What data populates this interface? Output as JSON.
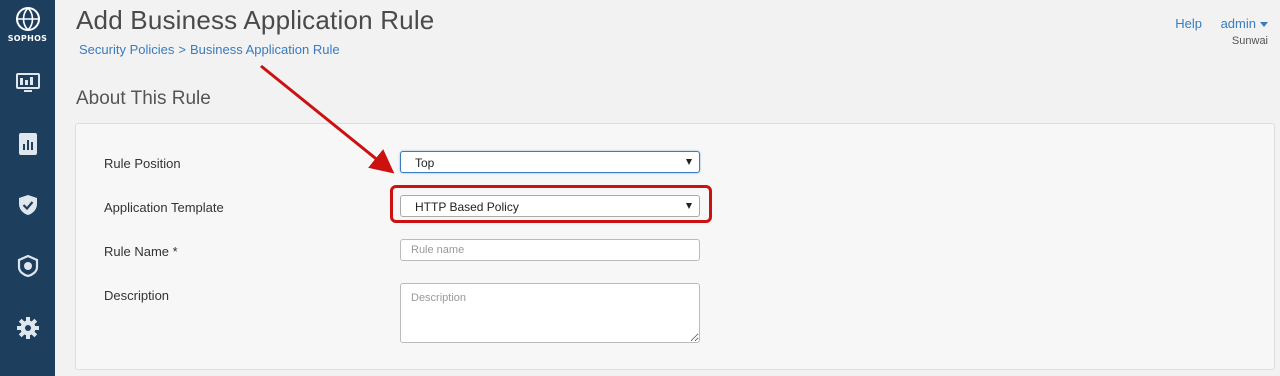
{
  "sidebar": {
    "brand": "SOPHOS",
    "items": [
      {
        "icon": "monitor-icon"
      },
      {
        "icon": "report-icon"
      },
      {
        "icon": "shield-icon"
      },
      {
        "icon": "protect-icon"
      },
      {
        "icon": "gear-icon"
      }
    ]
  },
  "header": {
    "title": "Add Business Application Rule",
    "breadcrumb": {
      "parent": "Security Policies",
      "separator": ">",
      "current": "Business Application Rule"
    },
    "help": "Help",
    "user": "admin",
    "org": "Sunwai"
  },
  "section": {
    "title": "About This Rule"
  },
  "form": {
    "rule_position": {
      "label": "Rule Position",
      "value": "Top"
    },
    "application_template": {
      "label": "Application Template",
      "value": "HTTP Based Policy"
    },
    "rule_name": {
      "label": "Rule Name *",
      "placeholder": "Rule name",
      "value": ""
    },
    "description": {
      "label": "Description",
      "placeholder": "Description",
      "value": ""
    }
  },
  "annotation": {
    "color": "#cc1111"
  }
}
